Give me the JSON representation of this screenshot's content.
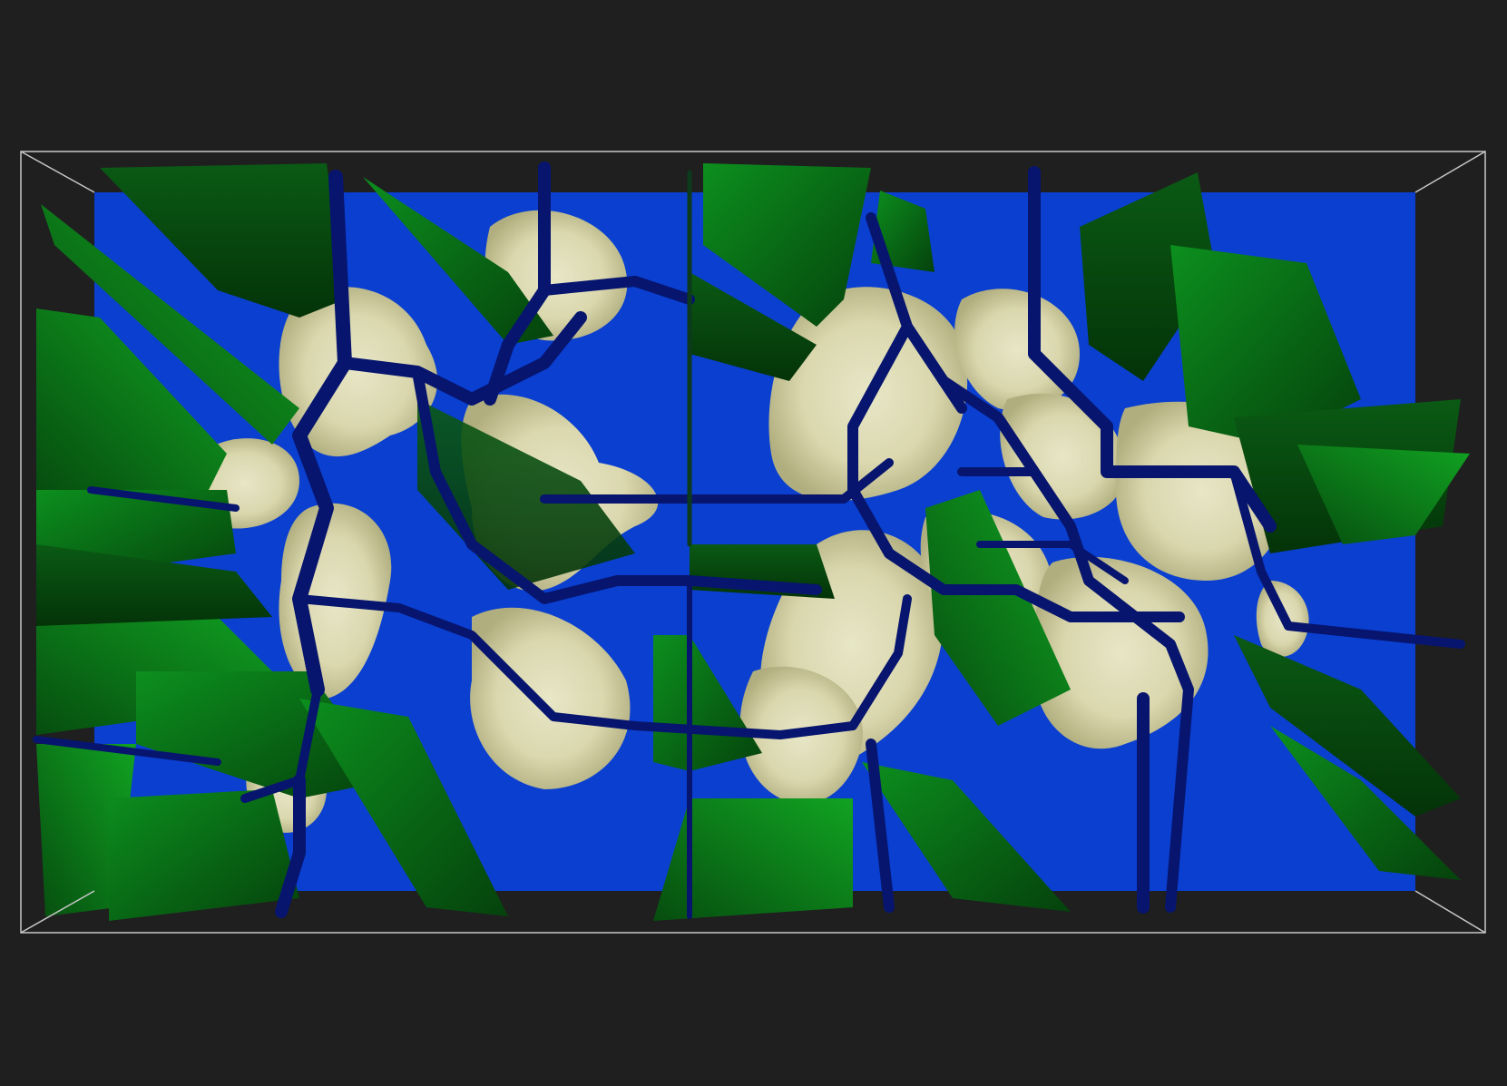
{
  "viewer": {
    "background_color": "#1f1f1f",
    "bounding_box_color": "#c8c8c8"
  },
  "surfaces": [
    {
      "name": "blue-isosurface",
      "color": "#0a3fd0"
    },
    {
      "name": "green-isosurface",
      "color": "#0b7a16"
    },
    {
      "name": "cream-isosurface",
      "color": "#e9e4b4"
    },
    {
      "name": "dark-blue-channels",
      "color": "#07156e"
    }
  ]
}
